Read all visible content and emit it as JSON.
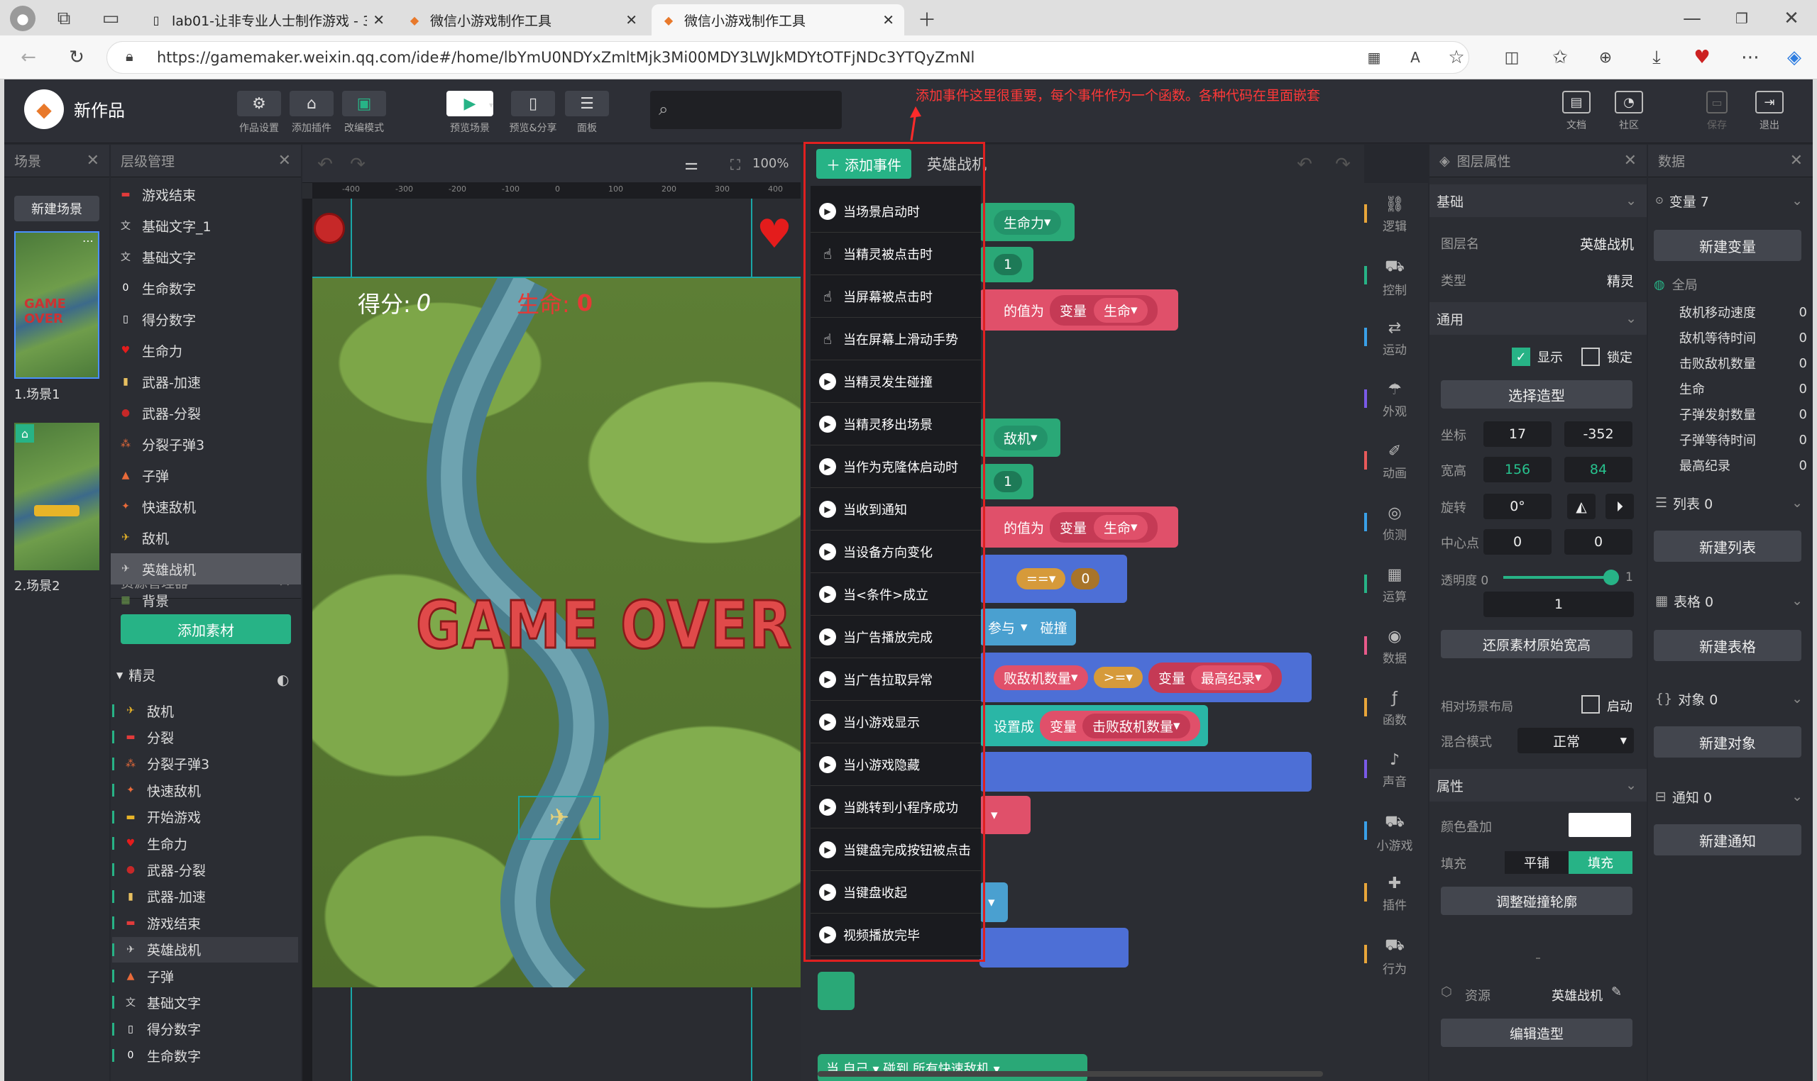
{
  "browser": {
    "tabs": [
      {
        "title": "lab01-让非专业人士制作游戏 - 3C"
      },
      {
        "title": "微信小游戏制作工具"
      },
      {
        "title": "微信小游戏制作工具"
      }
    ],
    "url": "https://gamemaker.weixin.qq.com/ide#/home/lbYmU0NDYxZmltMjk3Mi00MDY3LWJkMDYtOTFjNDc3YTQyZmNl"
  },
  "app": {
    "title": "新作品",
    "toolbar": [
      "作品设置",
      "添加插件",
      "改编模式",
      "预览场景",
      "预览&分享",
      "面板"
    ],
    "annotation": "添加事件这里很重要，每个事件作为一个函数。各种代码在里面嵌套",
    "right_toolbar": [
      "文档",
      "社区",
      "保存",
      "退出"
    ]
  },
  "scene_panel": {
    "title": "场景",
    "new_btn": "新建场景",
    "scenes": [
      "1.场景1",
      "2.场景2"
    ]
  },
  "hierarchy": {
    "title": "层级管理",
    "items": [
      "游戏结束",
      "基础文字_1",
      "基础文字",
      "生命数字",
      "得分数字",
      "生命力",
      "武器-加速",
      "武器-分裂",
      "分裂子弹3",
      "子弹",
      "快速敌机",
      "敌机",
      "英雄战机",
      "背景"
    ],
    "selected": "英雄战机"
  },
  "assets": {
    "title": "资源管理器",
    "add_btn": "添加素材",
    "group": "精灵",
    "items": [
      "敌机",
      "分裂",
      "分裂子弹3",
      "快速敌机",
      "开始游戏",
      "生命力",
      "武器-分裂",
      "武器-加速",
      "游戏结束",
      "英雄战机",
      "子弹",
      "基础文字",
      "得分数字",
      "生命数字"
    ]
  },
  "canvas": {
    "zoom": "100%",
    "score_label": "得分:",
    "score_val": "0",
    "life_label": "生命:",
    "life_val": "0",
    "game_over": "GAME OVER",
    "ruler": [
      "-400",
      "-300",
      "-200",
      "-100",
      "0",
      "100",
      "200",
      "300",
      "400"
    ]
  },
  "code": {
    "add_event": "添加事件",
    "sprite": "英雄战机",
    "events": [
      "当场景启动时",
      "当精灵被点击时",
      "当屏幕被点击时",
      "当在屏幕上滑动手势",
      "当精灵发生碰撞",
      "当精灵移出场景",
      "当作为克隆体启动时",
      "当收到通知",
      "当设备方向变化",
      "当<条件>成立",
      "当广告播放完成",
      "当广告拉取异常",
      "当小游戏显示",
      "当小游戏隐藏",
      "当跳转到小程序成功",
      "当键盘完成按钮被点击",
      "当键盘收起",
      "视频播放完毕"
    ],
    "blocks": {
      "life_var": "生命力",
      "one": "1",
      "set_to": "的值为",
      "var": "变量",
      "life": "生命",
      "enemy": "敌机",
      "eq": "==",
      "zero": "0",
      "join": "参与",
      "collide": "碰撞",
      "kill_count": "败敌机数量",
      "gte": ">=",
      "high": "最高纪录",
      "setas": "设置成",
      "kill2": "击败敌机数量",
      "bottom": "当 自己 ▾ 碰到 所有快速敌机 ▾"
    }
  },
  "categories": [
    "逻辑",
    "控制",
    "运动",
    "外观",
    "动画",
    "侦测",
    "运算",
    "数据",
    "函数",
    "声音",
    "小游戏",
    "插件",
    "行为"
  ],
  "props": {
    "title": "图层属性",
    "basic": "基础",
    "layer_name_label": "图层名",
    "layer_name": "英雄战机",
    "type_label": "类型",
    "type": "精灵",
    "general": "通用",
    "show": "显示",
    "lock": "锁定",
    "choose_shape": "选择造型",
    "pos_label": "坐标",
    "x": "17",
    "y": "-352",
    "size_label": "宽高",
    "w": "156",
    "h": "84",
    "rot_label": "旋转",
    "rot": "0°",
    "center_label": "中心点",
    "cx": "0",
    "cy": "0",
    "opacity_label": "透明度 0",
    "opacity_max": "1",
    "opacity": "1",
    "opacity_level": 1,
    "restore": "还原素材原始宽高",
    "relative": "相对场景布局",
    "enable": "启动",
    "blend_label": "混合模式",
    "blend": "正常",
    "attr": "属性",
    "color_label": "颜色叠加",
    "fill_label": "填充",
    "tile": "平铺",
    "fill": "填充",
    "collision": "调整碰撞轮廓",
    "res_label": "资源",
    "res": "英雄战机",
    "edit_shape": "编辑造型"
  },
  "data": {
    "title": "数据",
    "vars_head": "变量 7",
    "new_var": "新建变量",
    "global": "全局",
    "vars": [
      {
        "n": "敌机移动速度",
        "v": "0"
      },
      {
        "n": "敌机等待时间",
        "v": "0"
      },
      {
        "n": "击败敌机数量",
        "v": "0"
      },
      {
        "n": "生命",
        "v": "0"
      },
      {
        "n": "子弹发射数量",
        "v": "0"
      },
      {
        "n": "子弹等待时间",
        "v": "0"
      },
      {
        "n": "最高纪录",
        "v": "0"
      }
    ],
    "list_head": "列表 0",
    "new_list": "新建列表",
    "table_head": "表格 0",
    "new_table": "新建表格",
    "obj_head": "对象 0",
    "new_obj": "新建对象",
    "notice_head": "通知 0",
    "new_notice": "新建通知"
  }
}
